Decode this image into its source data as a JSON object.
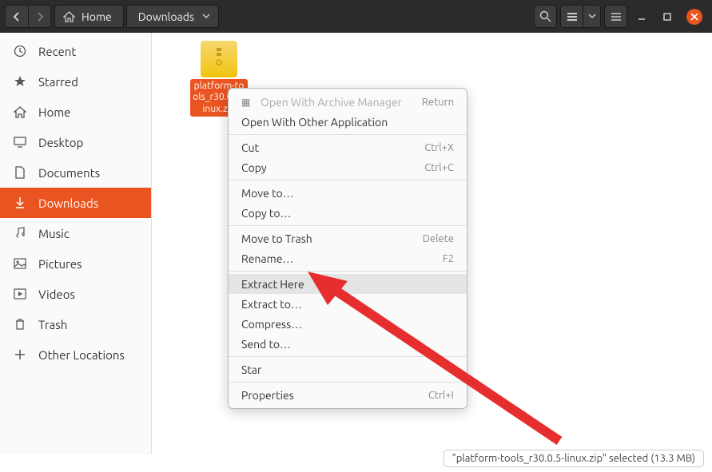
{
  "header": {
    "home_label": "Home",
    "downloads_label": "Downloads"
  },
  "sidebar": {
    "items": [
      {
        "label": "Recent"
      },
      {
        "label": "Starred"
      },
      {
        "label": "Home"
      },
      {
        "label": "Desktop"
      },
      {
        "label": "Documents"
      },
      {
        "label": "Downloads"
      },
      {
        "label": "Music"
      },
      {
        "label": "Pictures"
      },
      {
        "label": "Videos"
      },
      {
        "label": "Trash"
      },
      {
        "label": "Other Locations"
      }
    ]
  },
  "file": {
    "name_line1": "platform-",
    "name_line2": "tools_r30.0.5-linux.zip"
  },
  "context_menu": {
    "open_archive": "Open With Archive Manager",
    "open_archive_shortcut": "Return",
    "open_other": "Open With Other Application",
    "cut": "Cut",
    "cut_shortcut": "Ctrl+X",
    "copy": "Copy",
    "copy_shortcut": "Ctrl+C",
    "move_to": "Move to…",
    "copy_to": "Copy to…",
    "move_trash": "Move to Trash",
    "move_trash_shortcut": "Delete",
    "rename": "Rename…",
    "rename_shortcut": "F2",
    "extract_here": "Extract Here",
    "extract_to": "Extract to…",
    "compress": "Compress…",
    "send_to": "Send to…",
    "star": "Star",
    "properties": "Properties",
    "properties_shortcut": "Ctrl+I"
  },
  "statusbar": {
    "text": "\"platform-tools_r30.0.5-linux.zip\" selected  (13.3 MB)"
  }
}
